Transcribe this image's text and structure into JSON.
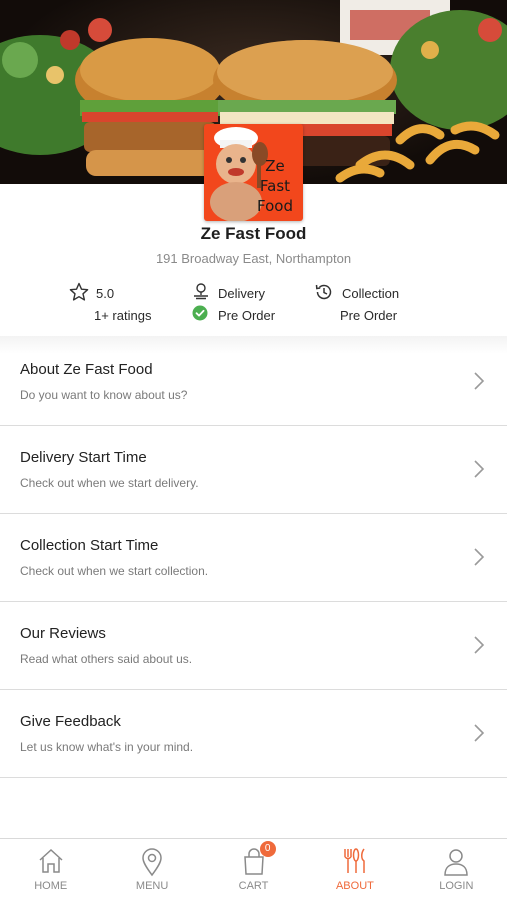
{
  "restaurant": {
    "name": "Ze Fast Food",
    "address": "191 Broadway East, Northampton",
    "logo_text": [
      "Ze",
      "Fast",
      "Food"
    ]
  },
  "info": {
    "rating": "5.0",
    "rating_count": "1+ ratings",
    "delivery_label": "Delivery",
    "delivery_status": "Pre Order",
    "collection_label": "Collection",
    "collection_status": "Pre Order"
  },
  "menu": [
    {
      "title": "About Ze Fast Food",
      "subtitle": "Do you want to know about us?"
    },
    {
      "title": "Delivery Start Time",
      "subtitle": "Check out when we start delivery."
    },
    {
      "title": "Collection Start Time",
      "subtitle": "Check out when we start collection."
    },
    {
      "title": "Our Reviews",
      "subtitle": "Read what others said about us."
    },
    {
      "title": "Give Feedback",
      "subtitle": "Let us know what's in your mind."
    }
  ],
  "nav": {
    "home": "HOME",
    "menu": "MENU",
    "cart": "CART",
    "cart_count": "0",
    "about": "ABOUT",
    "login": "LOGIN"
  },
  "colors": {
    "accent": "#ef6a3b",
    "logo_bg": "#f2471c",
    "check_green": "#4caf50"
  },
  "icons": [
    "star-icon",
    "delivery-icon",
    "check-icon",
    "history-icon",
    "chevron-right-icon",
    "home-icon",
    "location-pin-icon",
    "cart-icon",
    "cutlery-icon",
    "user-icon"
  ]
}
